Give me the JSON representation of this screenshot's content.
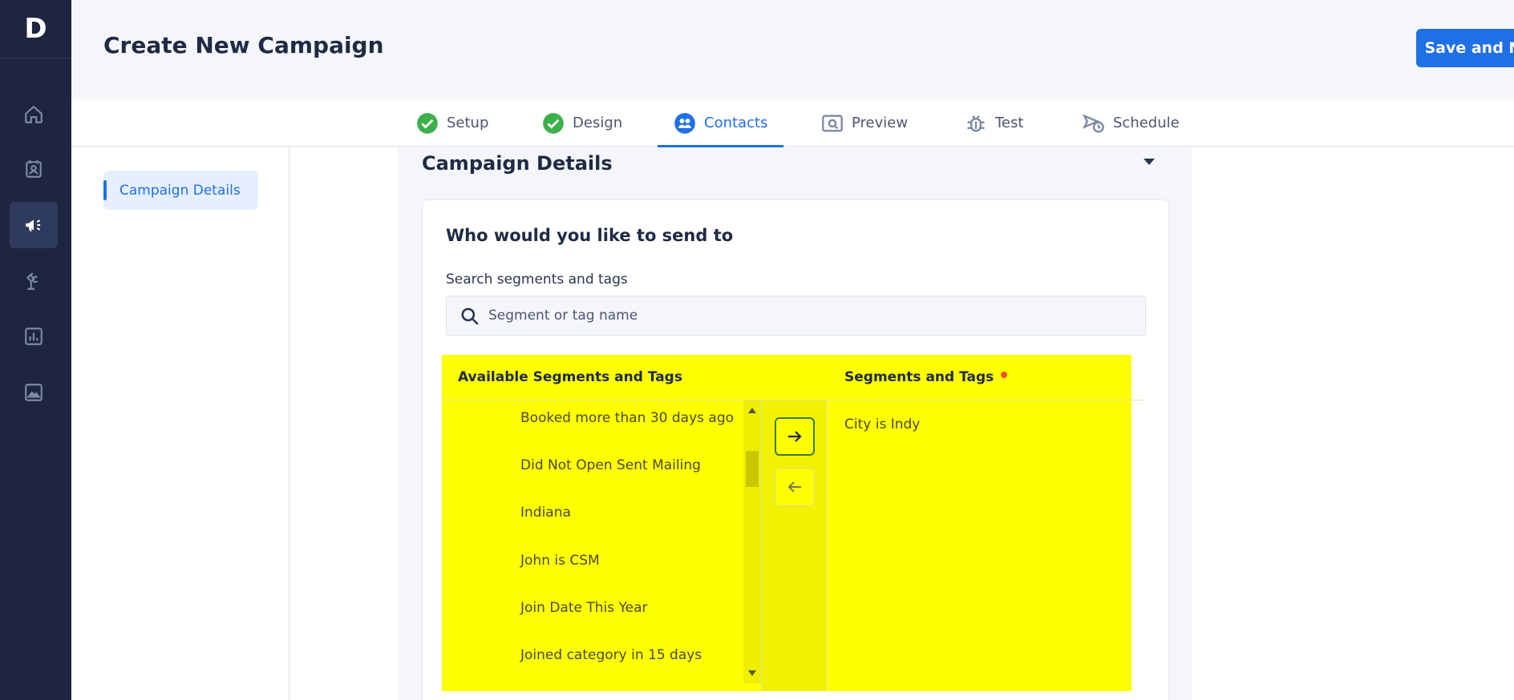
{
  "app": {
    "logo_letter": "D",
    "title": "Create New Campaign",
    "save_button": "Save and Next"
  },
  "sidebar": {
    "items": [
      {
        "icon": "home-icon",
        "active": false
      },
      {
        "icon": "contacts-card-icon",
        "active": false
      },
      {
        "icon": "megaphone-icon",
        "active": true
      },
      {
        "icon": "automation-icon",
        "active": false
      },
      {
        "icon": "bar-chart-icon",
        "active": false
      },
      {
        "icon": "image-icon",
        "active": false
      }
    ]
  },
  "tabs": [
    {
      "label": "Setup",
      "icon": "check-circle-icon",
      "state": "done"
    },
    {
      "label": "Design",
      "icon": "check-circle-icon",
      "state": "done"
    },
    {
      "label": "Contacts",
      "icon": "contacts-group-icon",
      "state": "active"
    },
    {
      "label": "Preview",
      "icon": "preview-icon",
      "state": "todo"
    },
    {
      "label": "Test",
      "icon": "bug-icon",
      "state": "todo"
    },
    {
      "label": "Schedule",
      "icon": "schedule-send-icon",
      "state": "todo"
    }
  ],
  "left_nav": {
    "items": [
      "Campaign Details"
    ]
  },
  "section": {
    "title": "Campaign Details"
  },
  "card": {
    "title": "Who would you like to send to",
    "search_label": "Search segments and tags",
    "search_placeholder": "Segment or tag name",
    "available_header": "Available Segments and Tags",
    "selected_header": "Segments and Tags",
    "available_items": [
      "Booked more than 30 days ago",
      "Did Not Open Sent Mailing",
      "Indiana",
      "John is CSM",
      "Join Date This Year",
      "Joined category in 15 days"
    ],
    "selected_items": [
      "City is Indy"
    ]
  },
  "colors": {
    "sidebar_bg": "#1d2540",
    "accent": "#1f6fe5",
    "success": "#3cb04a",
    "highlight": "#ffff00",
    "required_dot": "#f04d23"
  }
}
